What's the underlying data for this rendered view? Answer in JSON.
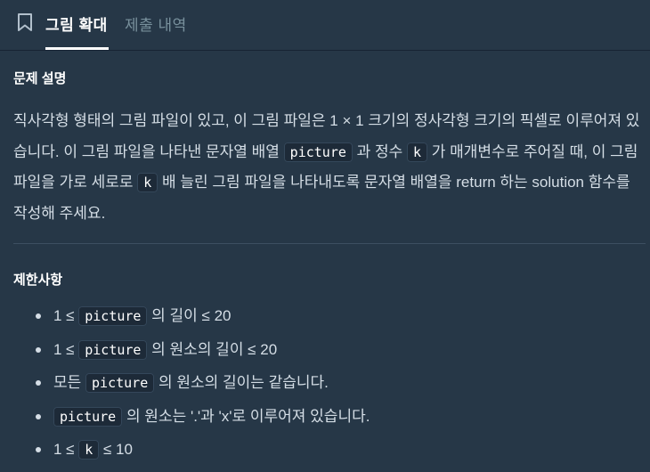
{
  "tabs": {
    "bookmark_icon": "bookmark-icon",
    "active_label": "그림 확대",
    "inactive_label": "제출 내역"
  },
  "problem": {
    "title": "문제 설명",
    "desc_1": "직사각형 형태의 그림 파일이 있고, 이 그림 파일은 1 × 1 크기의 정사각형 크기의 픽셀로 이루어져 있습니다. 이 그림 파일을 나타낸 문자열 배열 ",
    "code_picture": "picture",
    "desc_2": " 과 정수 ",
    "code_k": "k",
    "desc_3": " 가 매개변수로 주어질 때, 이 그림 파일을 가로 세로로 ",
    "code_k2": "k",
    "desc_4": " 배 늘린 그림 파일을 나타내도록 문자열 배열을 return 하는 solution 함수를 작성해 주세요."
  },
  "constraints": {
    "title": "제한사항",
    "items": [
      {
        "pre": "1 ≤ ",
        "code": "picture",
        "post": " 의 길이 ≤ 20"
      },
      {
        "pre": "1 ≤ ",
        "code": "picture",
        "post": " 의 원소의 길이 ≤ 20"
      },
      {
        "pre": "모든 ",
        "code": "picture",
        "post": " 의 원소의 길이는 같습니다."
      },
      {
        "pre": "",
        "code": "picture",
        "post": " 의 원소는 '.'과 'x'로 이루어져 있습니다."
      },
      {
        "pre": "1 ≤ ",
        "code": "k",
        "post": " ≤ 10"
      }
    ]
  }
}
